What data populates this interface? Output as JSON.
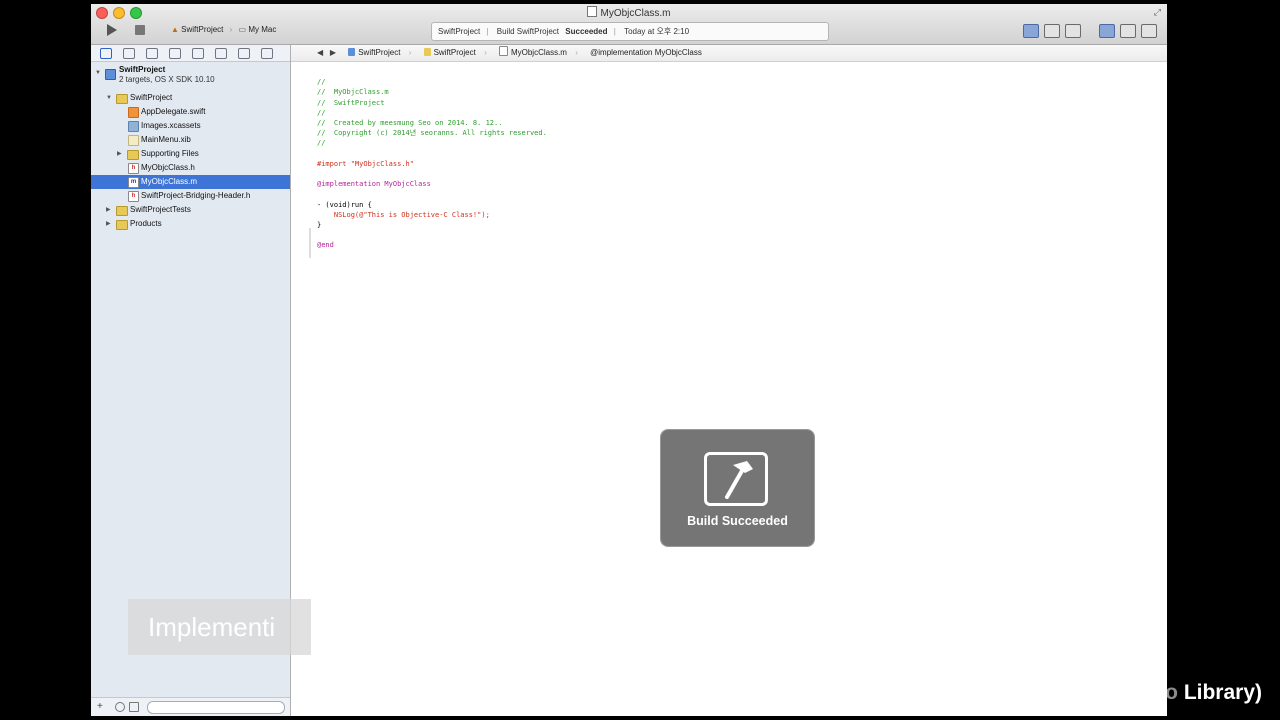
{
  "window": {
    "title": "MyObjcClass.m"
  },
  "toolbar": {
    "scheme": "SwiftProject",
    "destination": "My Mac",
    "activity": {
      "project": "SwiftProject",
      "build_prefix": "Build SwiftProject",
      "build_status": "Succeeded",
      "time": "Today at 오후 2:10"
    }
  },
  "navigator": {
    "project_name": "SwiftProject",
    "project_subtitle": "2 targets, OS X SDK 10.10",
    "items": [
      {
        "label": "SwiftProject",
        "icon": "folder-icon"
      },
      {
        "label": "AppDelegate.swift",
        "icon": "swift-file-icon"
      },
      {
        "label": "Images.xcassets",
        "icon": "asset-catalog-icon"
      },
      {
        "label": "MainMenu.xib",
        "icon": "xib-file-icon"
      },
      {
        "label": "Supporting Files",
        "icon": "folder-icon"
      },
      {
        "label": "MyObjcClass.h",
        "icon": "header-file-icon"
      },
      {
        "label": "MyObjcClass.m",
        "icon": "implementation-file-icon"
      },
      {
        "label": "SwiftProject-Bridging-Header.h",
        "icon": "header-file-icon"
      },
      {
        "label": "SwiftProjectTests",
        "icon": "folder-icon"
      },
      {
        "label": "Products",
        "icon": "folder-icon"
      }
    ]
  },
  "jumpbar": {
    "crumbs": [
      "SwiftProject",
      "SwiftProject",
      "MyObjcClass.m",
      "@implementation MyObjcClass"
    ]
  },
  "code": {
    "lines": [
      "//",
      "//  MyObjcClass.m",
      "//  SwiftProject",
      "//",
      "//  Created by meesmung Seo on 2014. 8. 12..",
      "//  Copyright (c) 2014년 seoranns. All rights reserved.",
      "//",
      "",
      "#import \"MyObjcClass.h\"",
      "",
      "@implementation MyObjcClass",
      "",
      "- (void)run {",
      "    NSLog(@\"This is Objective-C Class!\");",
      "}",
      "",
      "@end"
    ]
  },
  "hud": {
    "label": "Build Succeeded",
    "icon": "hammer-icon"
  },
  "overlay": {
    "caption": "Implementi",
    "bgm_faded": "BGM: Trancer (from Youtube Audio ",
    "bgm_solid": "Library)"
  },
  "colors": {
    "selection": "#3d74d5",
    "comment": "#2e9e2e",
    "keyword": "#b5239a",
    "string": "#d12f1b"
  }
}
